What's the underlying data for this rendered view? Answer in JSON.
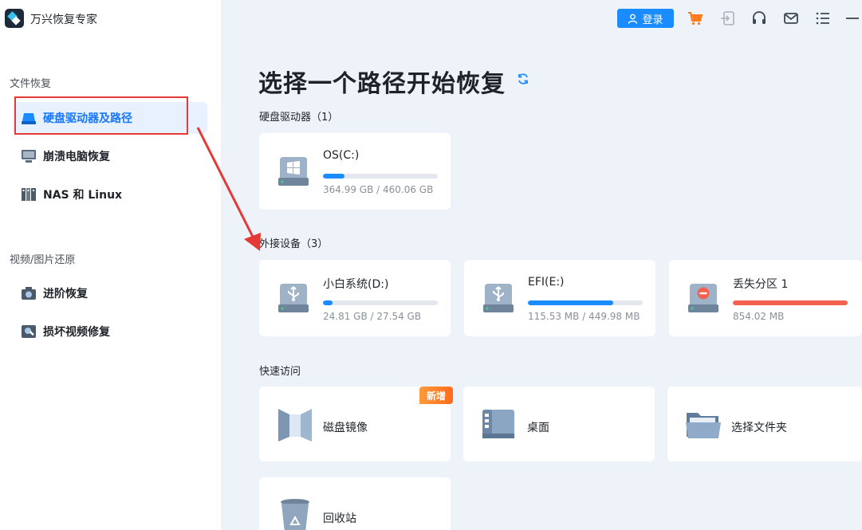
{
  "app": {
    "title": "万兴恢复专家"
  },
  "sidebar": {
    "section1": "文件恢复",
    "items1": [
      {
        "label": "硬盘驱动器及路径",
        "icon": "hard-drive-icon",
        "active": true
      },
      {
        "label": "崩溃电脑恢复",
        "icon": "monitor-icon"
      },
      {
        "label": "NAS 和 Linux",
        "icon": "nas-server-icon"
      }
    ],
    "section2": "视频/图片还原",
    "items2": [
      {
        "label": "进阶恢复",
        "icon": "camera-icon"
      },
      {
        "label": "损坏视频修复",
        "icon": "video-repair-icon"
      }
    ]
  },
  "topbar": {
    "login_label": "登录",
    "icons": [
      "cart-icon",
      "sign-in-icon",
      "headset-icon",
      "mail-icon",
      "menu-icon",
      "minimize-icon"
    ]
  },
  "main": {
    "title": "选择一个路径开始恢复",
    "hdd_group": "硬盘驱动器（1）",
    "external_group": "外接设备（3）",
    "quick_group": "快速访问",
    "drives": [
      {
        "name": "OS(C:)",
        "size": "364.99 GB / 460.06 GB",
        "used_fraction": 0.19,
        "color": "#1a8cff"
      }
    ],
    "external": [
      {
        "name": "小白系统(D:)",
        "size": "24.81 GB / 27.54 GB",
        "used_fraction": 0.08,
        "color": "#1a8cff"
      },
      {
        "name": "EFI(E:)",
        "size": "115.53 MB / 449.98 MB",
        "used_fraction": 0.74,
        "color": "#1a8cff"
      },
      {
        "name": "丢失分区 1",
        "size": "854.02 MB",
        "used_fraction": 1.0,
        "color": "#f4614f"
      }
    ],
    "quick": [
      {
        "label": "磁盘镜像",
        "badge": "新增"
      },
      {
        "label": "桌面"
      },
      {
        "label": "选择文件夹"
      },
      {
        "label": "回收站"
      }
    ]
  },
  "colors": {
    "accent": "#1a8cff",
    "danger": "#f4614f",
    "highlight": "#e53935"
  }
}
